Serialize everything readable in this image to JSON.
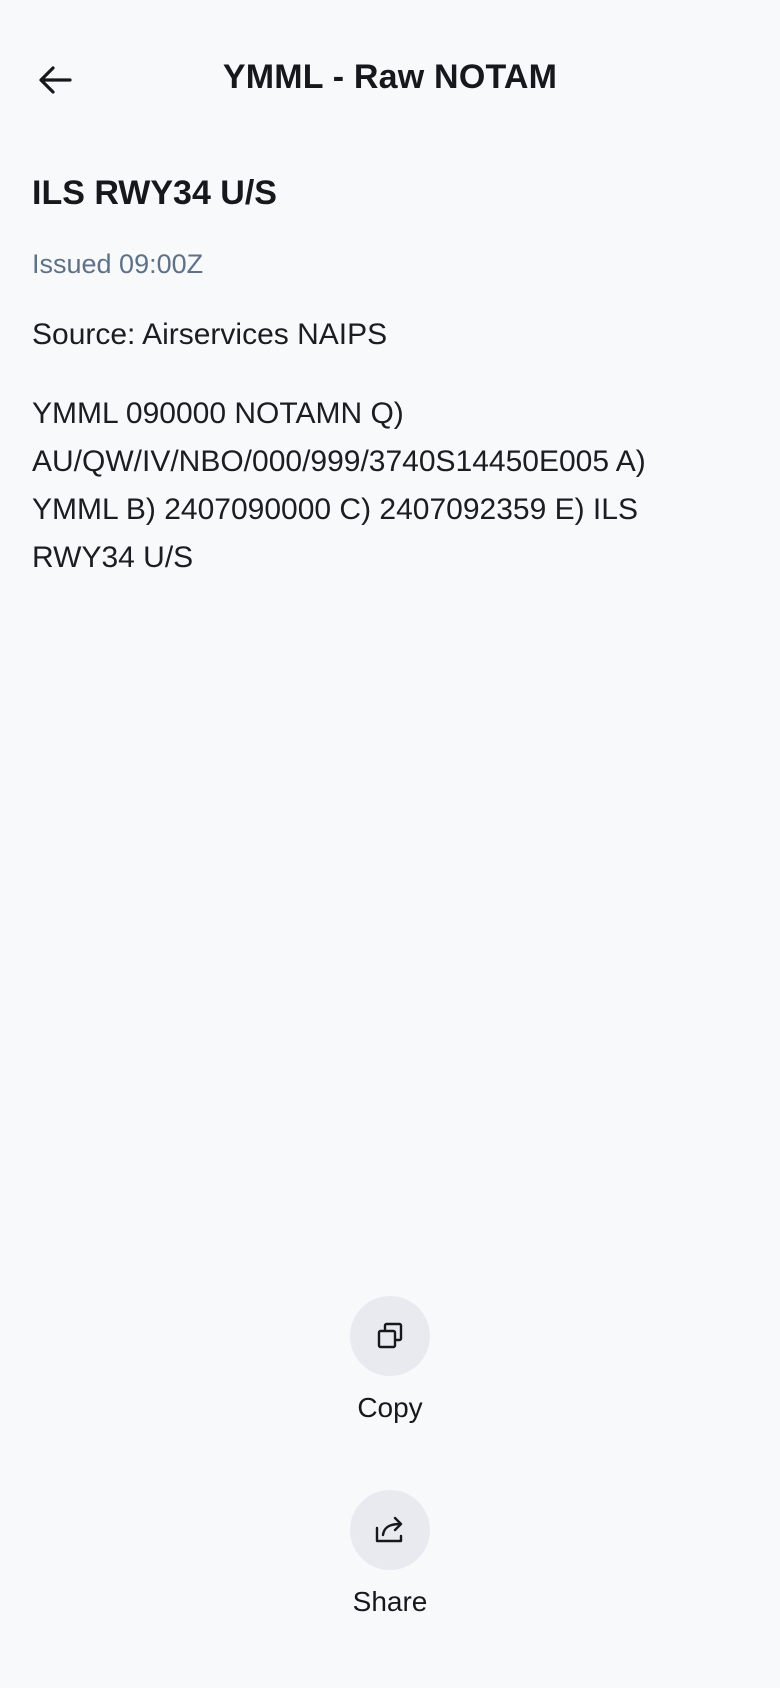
{
  "header": {
    "title": "YMML - Raw NOTAM",
    "back_icon": "arrow-left-icon"
  },
  "notam": {
    "title": "ILS RWY34 U/S",
    "issued": "Issued 09:00Z",
    "source": "Source: Airservices NAIPS",
    "raw": "YMML 090000 NOTAMN Q) AU/QW/IV/NBO/000/999/3740S14450E005 A) YMML B) 2407090000 C) 2407092359 E) ILS RWY34 U/S"
  },
  "actions": {
    "copy": {
      "label": "Copy",
      "icon": "copy-icon"
    },
    "share": {
      "label": "Share",
      "icon": "share-icon"
    }
  },
  "colors": {
    "background": "#f8f9fb",
    "text": "#16181c",
    "muted": "#5e7187",
    "button_bg": "#e8eaef"
  }
}
